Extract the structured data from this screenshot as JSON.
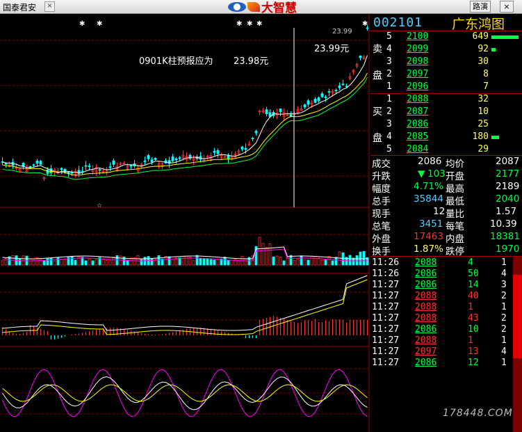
{
  "window": {
    "broker": "国泰君安",
    "logo_text": "大智慧",
    "btn_route": "路演",
    "btn_close": "×",
    "close_small": "×"
  },
  "chart": {
    "annotation_text": "0901K柱预报应为",
    "annotation_price": "23.98元",
    "top_price_label": "23.99元",
    "peak_label": "23.99",
    "cross_marker": "☆"
  },
  "quote": {
    "code": "002101",
    "name": "广东鸿图",
    "sell_label_top": "卖",
    "sell_label_bottom": "盘",
    "buy_label_top": "买",
    "buy_label_bottom": "盘",
    "sell": [
      {
        "level": "5",
        "price": "2100",
        "volume": "649",
        "bar": 0.55
      },
      {
        "level": "4",
        "price": "2099",
        "volume": "92",
        "bar": 0.08
      },
      {
        "level": "3",
        "price": "2098",
        "volume": "30",
        "bar": 0
      },
      {
        "level": "2",
        "price": "2097",
        "volume": "8",
        "bar": 0
      },
      {
        "level": "1",
        "price": "2096",
        "volume": "7",
        "bar": 0
      }
    ],
    "buy": [
      {
        "level": "1",
        "price": "2088",
        "volume": "32",
        "bar": 0
      },
      {
        "level": "2",
        "price": "2087",
        "volume": "10",
        "bar": 0
      },
      {
        "level": "3",
        "price": "2086",
        "volume": "25",
        "bar": 0
      },
      {
        "level": "4",
        "price": "2085",
        "volume": "180",
        "bar": 0.15
      },
      {
        "level": "5",
        "price": "2084",
        "volume": "29",
        "bar": 0
      }
    ],
    "stats": {
      "deal_label": "成交",
      "deal": "2086",
      "avg_label": "均价",
      "avg": "2087",
      "change_label": "升跌",
      "change": "103",
      "open_label": "开盘",
      "open": "2177",
      "pct_label": "幅度",
      "pct": "4.71%",
      "high_label": "最高",
      "high": "2189",
      "volume_label": "总手",
      "volume": "35844",
      "low_label": "最低",
      "low": "2040",
      "cur_label": "现手",
      "cur": "12",
      "ratio_label": "量比",
      "ratio": "1.57",
      "trades_label": "总笔",
      "trades": "3451",
      "per_label": "每笔",
      "per": "10.39",
      "outer_label": "外盘",
      "outer": "17463",
      "inner_label": "内盘",
      "inner": "18381",
      "turn_label": "换手",
      "turn": "1.87%",
      "limit_label": "跌停",
      "limit": "1970"
    },
    "ticks": [
      {
        "time": "11:26",
        "price": "2088",
        "vol": "4",
        "n": "1",
        "color": "#00ff40"
      },
      {
        "time": "11:26",
        "price": "2086",
        "vol": "50",
        "n": "4",
        "color": "#00ff40"
      },
      {
        "time": "11:27",
        "price": "2086",
        "vol": "14",
        "n": "3",
        "color": "#00ff40"
      },
      {
        "time": "11:27",
        "price": "2088",
        "vol": "40",
        "n": "2",
        "color": "#ff3030"
      },
      {
        "time": "11:27",
        "price": "2088",
        "vol": "1",
        "n": "1",
        "color": "#ff3030"
      },
      {
        "time": "11:27",
        "price": "2088",
        "vol": "43",
        "n": "2",
        "color": "#ff3030"
      },
      {
        "time": "11:27",
        "price": "2086",
        "vol": "10",
        "n": "2",
        "color": "#00ff40"
      },
      {
        "time": "11:27",
        "price": "2088",
        "vol": "1",
        "n": "1",
        "color": "#ff3030"
      },
      {
        "time": "11:27",
        "price": "2097",
        "vol": "13",
        "n": "4",
        "color": "#ff3030"
      },
      {
        "time": "11:27",
        "price": "2086",
        "vol": "12",
        "n": "1",
        "color": "#00ff40"
      }
    ]
  },
  "watermark": "178448.COM",
  "colors": {
    "up": "#ff3030",
    "down": "#00ffff",
    "bg": "#000000",
    "grid": "#a00000"
  }
}
